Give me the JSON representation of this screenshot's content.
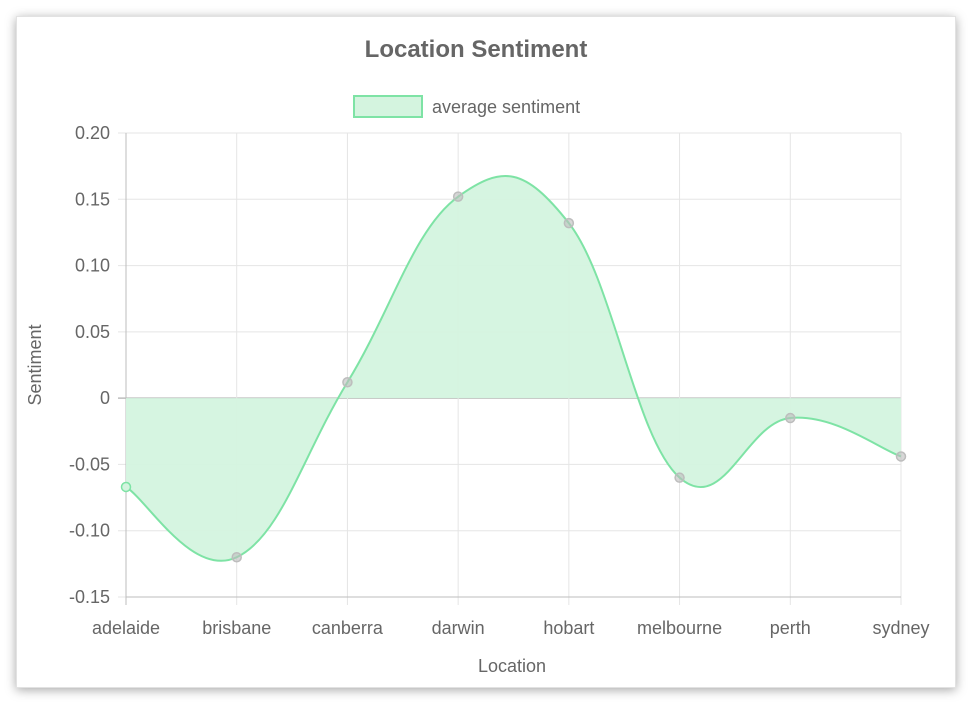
{
  "chart_data": {
    "type": "area",
    "title": "Location Sentiment",
    "xlabel": "Location",
    "ylabel": "Sentiment",
    "categories": [
      "adelaide",
      "brisbane",
      "canberra",
      "darwin",
      "hobart",
      "melbourne",
      "perth",
      "sydney"
    ],
    "series": [
      {
        "name": "average sentiment",
        "values": [
          -0.067,
          -0.12,
          0.012,
          0.152,
          0.132,
          -0.06,
          -0.015,
          -0.044
        ],
        "line_color": "#7ee3a5",
        "fill_color": "#d4f4df",
        "point_color": "#bdbdbd"
      }
    ],
    "ylim": [
      -0.15,
      0.2
    ],
    "y_ticks": [
      "0.20",
      "0.15",
      "0.10",
      "0.05",
      "0",
      "-0.05",
      "-0.10",
      "-0.15"
    ],
    "grid": true,
    "legend_position": "top"
  }
}
